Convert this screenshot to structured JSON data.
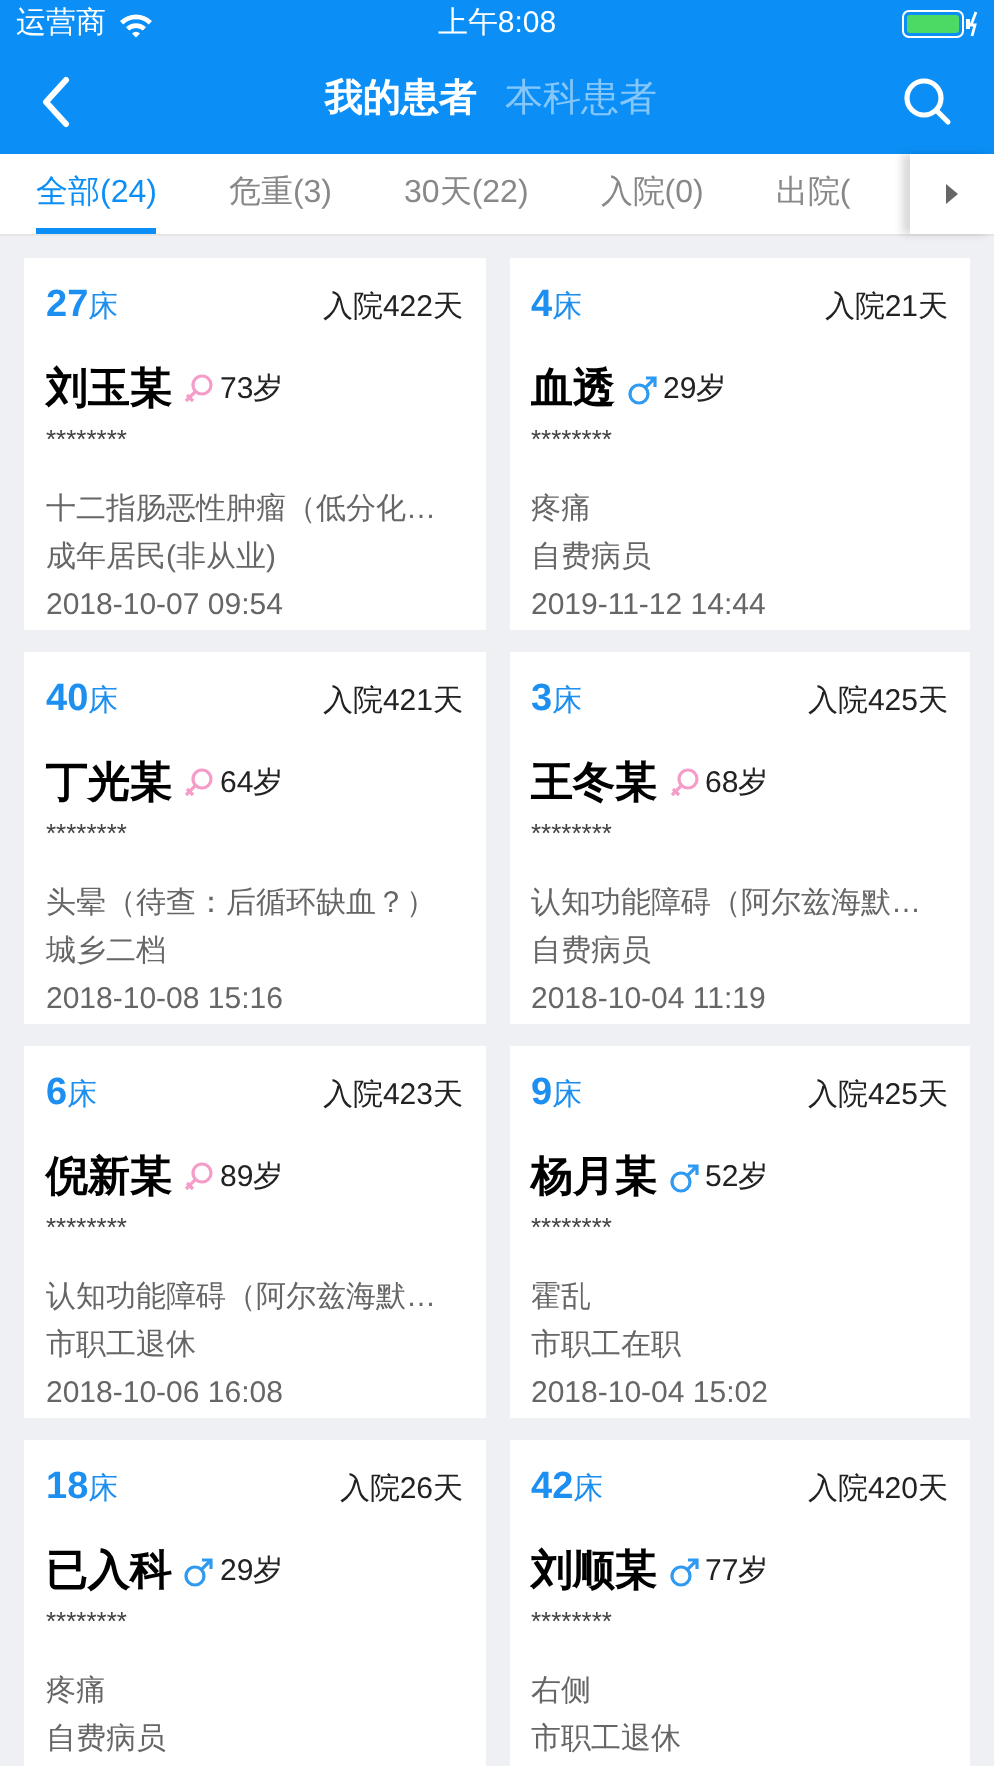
{
  "status_bar": {
    "carrier": "运营商",
    "time": "上午8:08"
  },
  "header": {
    "segments": [
      {
        "label": "我的患者",
        "selected": true
      },
      {
        "label": "本科患者",
        "selected": false
      }
    ]
  },
  "tabs": [
    {
      "label": "全部(24)",
      "selected": true
    },
    {
      "label": "危重(3)",
      "selected": false
    },
    {
      "label": "30天(22)",
      "selected": false
    },
    {
      "label": "入院(0)",
      "selected": false
    },
    {
      "label": "出院(",
      "selected": false
    }
  ],
  "patients": [
    {
      "bed_number": "27",
      "bed_unit": "床",
      "stay": "入院422天",
      "name": "刘玉某",
      "kind": "female",
      "age": "73岁",
      "id": "********",
      "diagnosis": "十二指肠恶性肿瘤（低分化…",
      "insurance": "成年居民(非从业)",
      "date": "2018-10-07 09:54"
    },
    {
      "bed_number": "4",
      "bed_unit": "床",
      "stay": "入院21天",
      "name": "血透",
      "kind": "male",
      "age": "29岁",
      "id": "********",
      "diagnosis": "疼痛",
      "insurance": "自费病员",
      "date": "2019-11-12 14:44"
    },
    {
      "bed_number": "40",
      "bed_unit": "床",
      "stay": "入院421天",
      "name": "丁光某",
      "kind": "female",
      "age": "64岁",
      "id": "********",
      "diagnosis": "头晕（待查：后循环缺血？）",
      "insurance": "城乡二档",
      "date": "2018-10-08 15:16"
    },
    {
      "bed_number": "3",
      "bed_unit": "床",
      "stay": "入院425天",
      "name": "王冬某",
      "kind": "female",
      "age": "68岁",
      "id": "********",
      "diagnosis": "认知功能障碍（阿尔兹海默…",
      "insurance": "自费病员",
      "date": "2018-10-04 11:19"
    },
    {
      "bed_number": "6",
      "bed_unit": "床",
      "stay": "入院423天",
      "name": "倪新某",
      "kind": "female",
      "age": "89岁",
      "id": "********",
      "diagnosis": "认知功能障碍（阿尔兹海默…",
      "insurance": "市职工退休",
      "date": "2018-10-06 16:08"
    },
    {
      "bed_number": "9",
      "bed_unit": "床",
      "stay": "入院425天",
      "name": "杨月某",
      "kind": "male",
      "age": "52岁",
      "id": "********",
      "diagnosis": "霍乱",
      "insurance": "市职工在职",
      "date": "2018-10-04 15:02"
    },
    {
      "bed_number": "18",
      "bed_unit": "床",
      "stay": "入院26天",
      "name": "已入科",
      "kind": "male",
      "age": "29岁",
      "id": "********",
      "diagnosis": "疼痛",
      "insurance": "自费病员"
    },
    {
      "bed_number": "42",
      "bed_unit": "床",
      "stay": "入院420天",
      "name": "刘顺某",
      "kind": "male",
      "age": "77岁",
      "id": "********",
      "diagnosis": "右侧",
      "insurance": "市职工退休"
    }
  ]
}
